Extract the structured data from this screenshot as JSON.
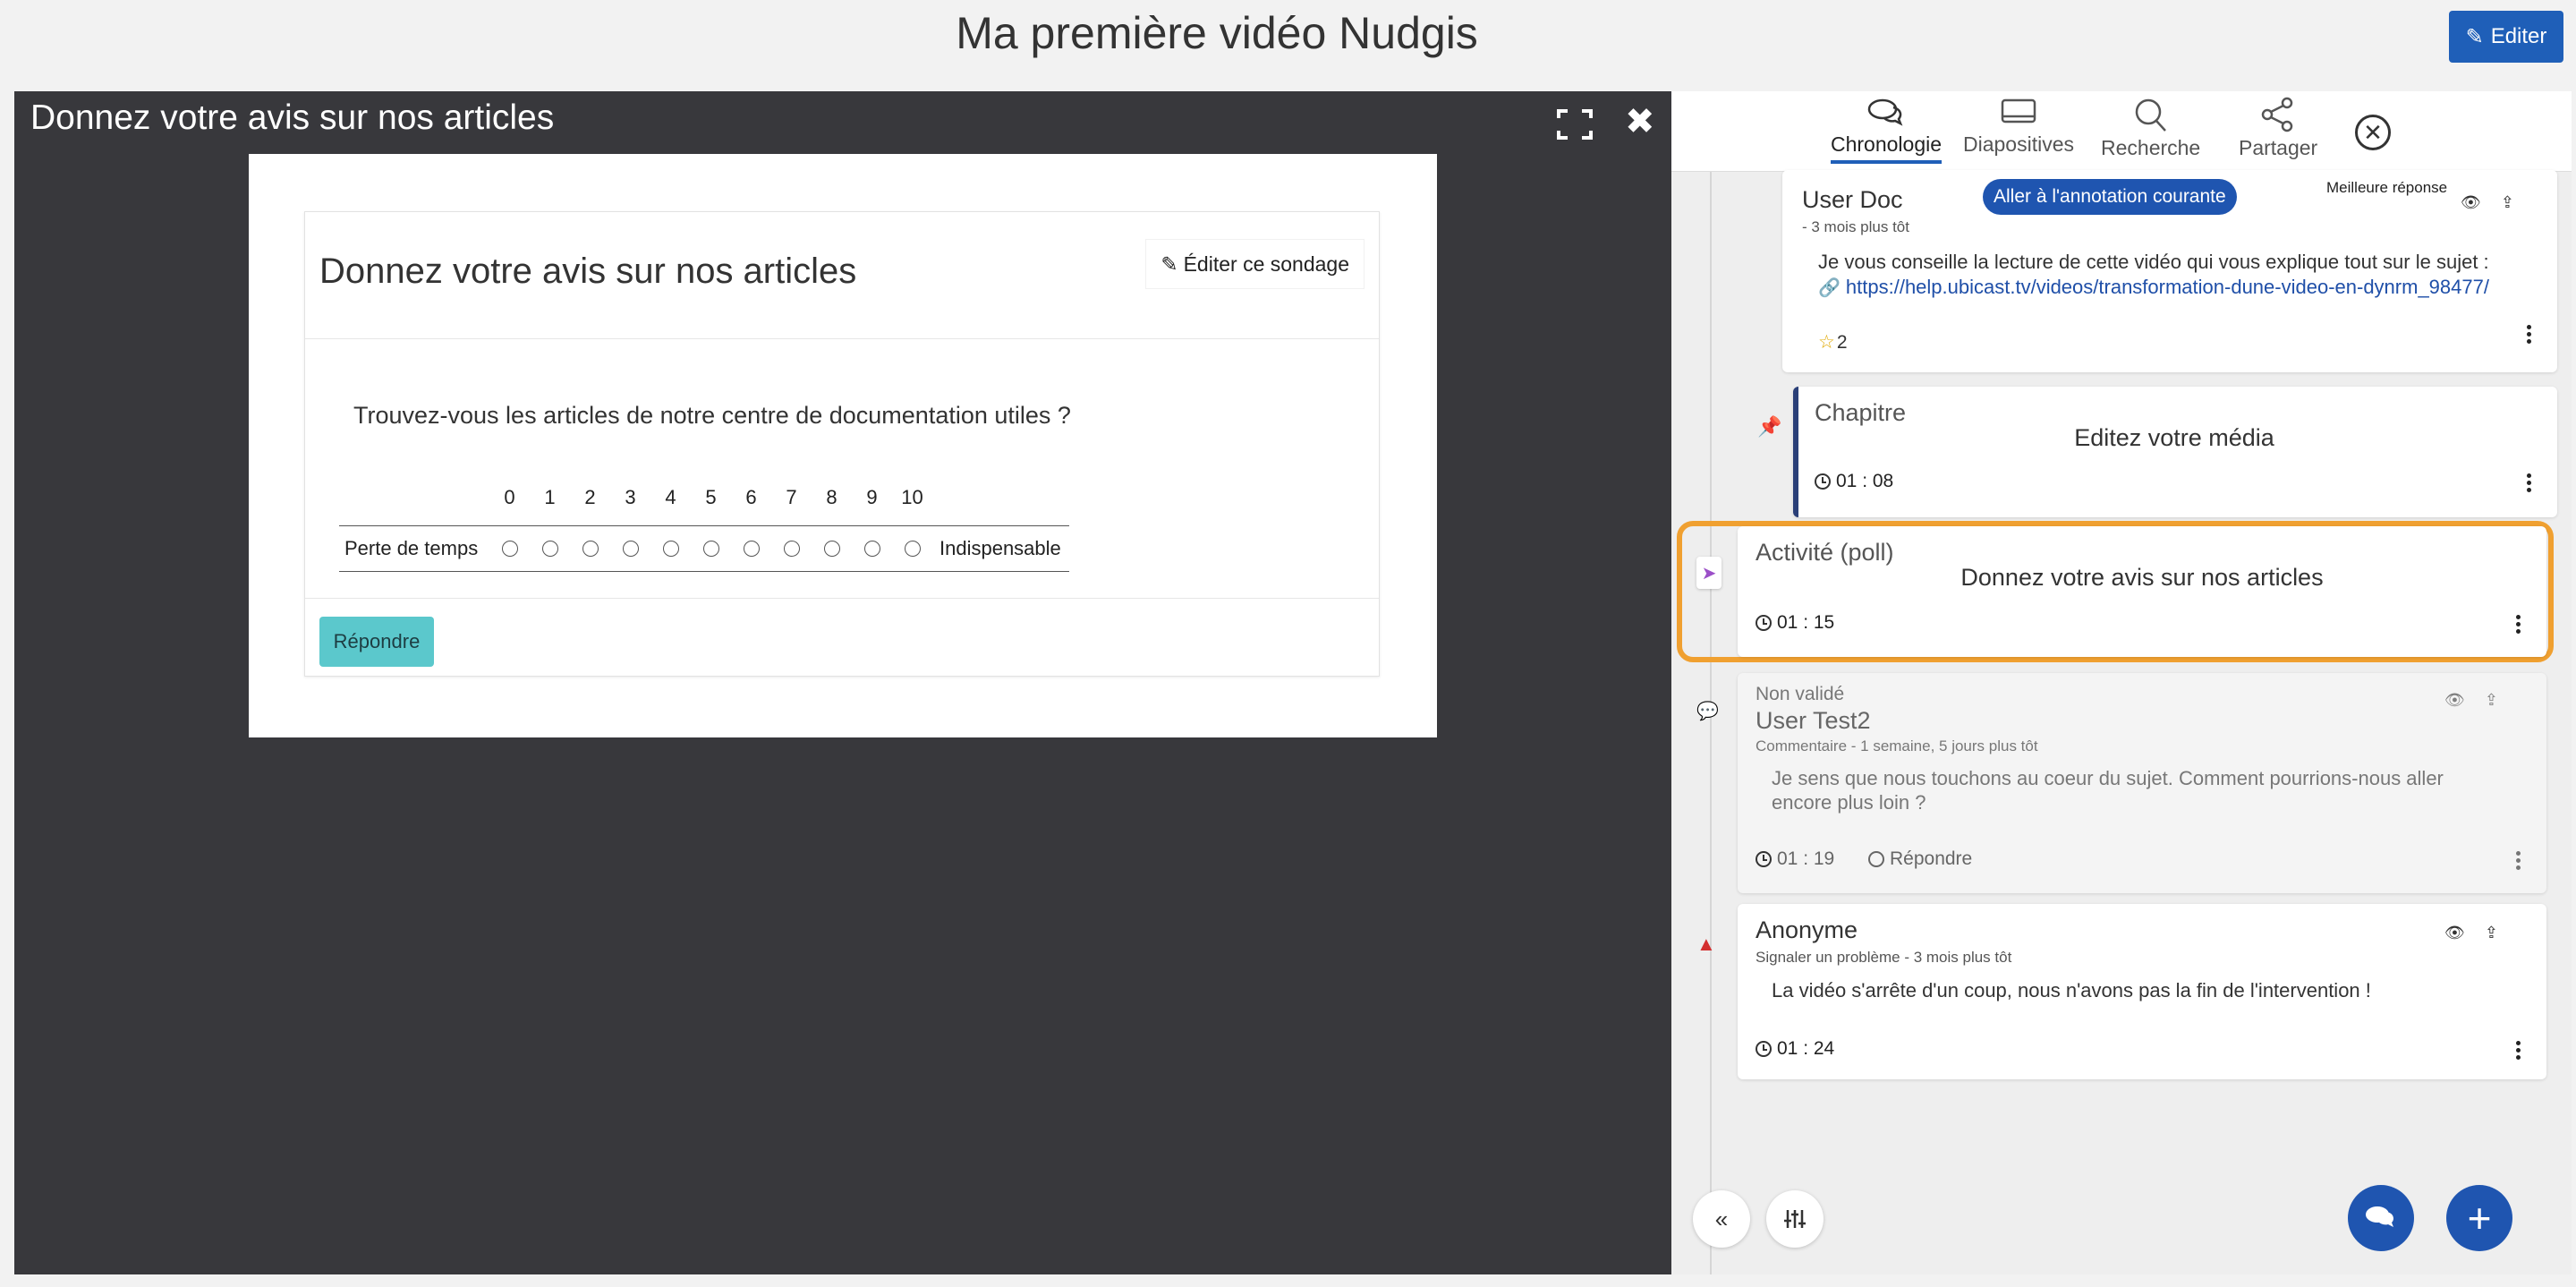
{
  "header": {
    "title": "Ma première vidéo Nudgis",
    "edit_label": "Editer"
  },
  "player": {
    "title": "Donnez votre avis sur nos articles",
    "poll": {
      "title": "Donnez votre avis sur nos articles",
      "edit_label": "Éditer ce sondage",
      "question": "Trouvez-vous les articles de notre centre de documentation utiles ?",
      "scale": [
        "0",
        "1",
        "2",
        "3",
        "4",
        "5",
        "6",
        "7",
        "8",
        "9",
        "10"
      ],
      "low_label": "Perte de temps",
      "high_label": "Indispensable",
      "reply_label": "Répondre"
    }
  },
  "panel": {
    "tabs": [
      {
        "label": "Chronologie",
        "icon": "chat-bubbles-icon",
        "active": true
      },
      {
        "label": "Diapositives",
        "icon": "slides-icon",
        "active": false
      },
      {
        "label": "Recherche",
        "icon": "search-icon",
        "active": false
      },
      {
        "label": "Partager",
        "icon": "share-icon",
        "active": false
      }
    ],
    "items": {
      "doc": {
        "author": "User Doc",
        "meta": "- 3 mois plus tôt",
        "goto_label": "Aller à l'annotation courante",
        "best_label": "Meilleure réponse",
        "text": "Je vous conseille la lecture de cette vidéo qui vous explique tout sur le sujet :",
        "link": "https://help.ubicast.tv/videos/transformation-dune-video-en-dynrm_98477/",
        "stars": "2"
      },
      "chapter": {
        "type": "Chapitre",
        "title": "Editez votre média",
        "time": "01 : 08"
      },
      "poll": {
        "type": "Activité (poll)",
        "title": "Donnez votre avis sur nos articles",
        "time": "01 : 15"
      },
      "comment": {
        "status": "Non validé",
        "author": "User Test2",
        "meta": "Commentaire - 1 semaine, 5 jours plus tôt",
        "text": "Je sens que nous touchons au coeur du sujet. Comment pourrions-nous aller encore plus loin ?",
        "time": "01 : 19",
        "reply_label": "Répondre"
      },
      "problem": {
        "author": "Anonyme",
        "meta": "Signaler un problème - 3 mois plus tôt",
        "text": "La vidéo s'arrête d'un coup, nous n'avons pas la fin de l'intervention !",
        "time": "01 : 24"
      }
    }
  },
  "colors": {
    "accent": "#1f55b0",
    "highlight": "#f0a030",
    "reply_button": "#5bc8cc",
    "player_bg": "#38383c"
  }
}
